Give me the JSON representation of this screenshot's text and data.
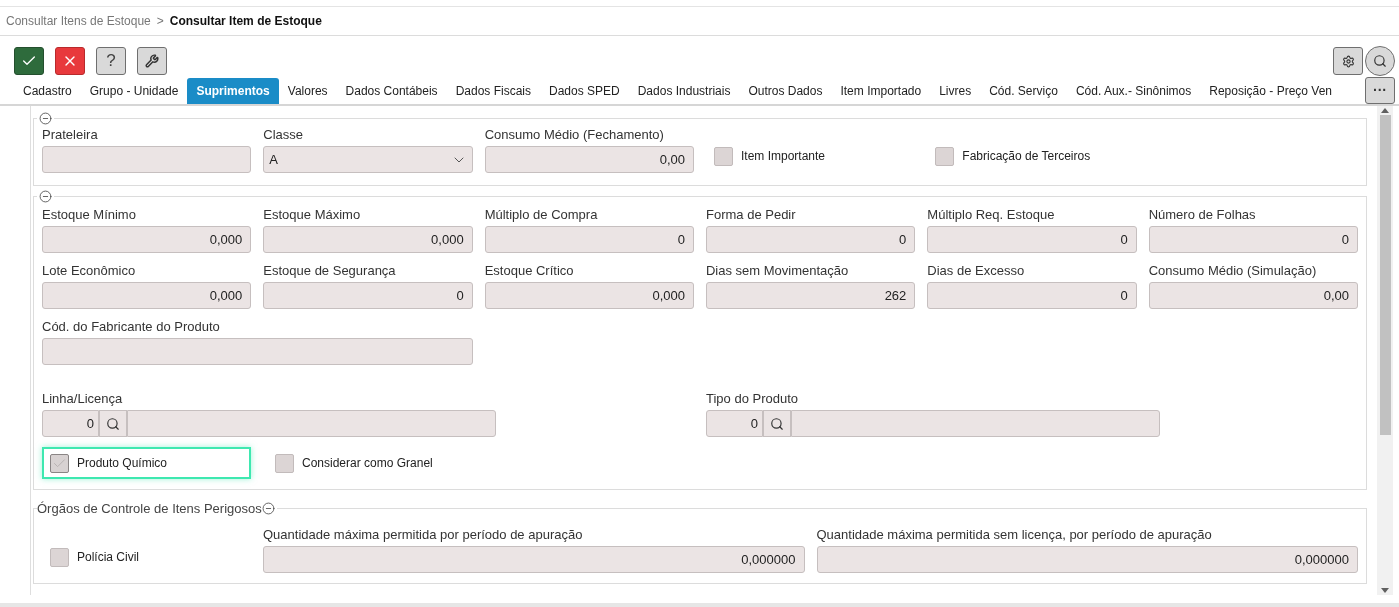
{
  "breadcrumb": [
    {
      "label": "Consultar Itens de Estoque",
      "current": false
    },
    {
      "label": ">",
      "current": false
    },
    {
      "label": "Consultar Item de Estoque",
      "current": true
    }
  ],
  "toolbar": [
    {
      "kind": "confirm"
    },
    {
      "kind": "cancel"
    },
    {
      "kind": "help",
      "label": "?"
    },
    {
      "kind": "tools"
    }
  ],
  "tabs": [
    {
      "label": "Cadastro",
      "selected": false
    },
    {
      "label": "Grupo - Unidade",
      "selected": false
    },
    {
      "label": "Suprimentos",
      "selected": true
    },
    {
      "label": "Valores",
      "selected": false
    },
    {
      "label": "Dados Contábeis",
      "selected": false
    },
    {
      "label": "Dados Fiscais",
      "selected": false
    },
    {
      "label": "Dados SPED",
      "selected": false
    },
    {
      "label": "Dados Industriais",
      "selected": false
    },
    {
      "label": "Outros Dados",
      "selected": false
    },
    {
      "label": "Item Importado",
      "selected": false
    },
    {
      "label": "Livres",
      "selected": false
    },
    {
      "label": "Cód. Serviço",
      "selected": false
    },
    {
      "label": "Cód. Aux.- Sinônimos",
      "selected": false
    },
    {
      "label": "Reposição - Preço Ven",
      "selected": false
    }
  ],
  "more_tabs": "···",
  "section_1": {
    "fields": [
      {
        "kind": "text",
        "label": "Prateleira"
      },
      {
        "kind": "select",
        "label": "Classe",
        "value": "A"
      },
      {
        "kind": "text",
        "label": "Consumo Médio (Fechamento)",
        "value": "0,00"
      },
      {
        "kind": "checkbox",
        "label": "Item Importante",
        "checked": false,
        "focused": false
      },
      {
        "kind": "checkbox",
        "label": "Fabricação de Terceiros",
        "checked": false,
        "focused": false
      }
    ]
  },
  "section_2": {
    "fields": [
      {
        "label": "Estoque Mínimo",
        "value": "0,000"
      },
      {
        "label": "Estoque Máximo",
        "value": "0,000"
      },
      {
        "label": "Múltiplo de Compra",
        "value": "0"
      },
      {
        "label": "Forma de Pedir",
        "value": "0"
      },
      {
        "label": "Múltiplo Req. Estoque",
        "value": "0"
      },
      {
        "label": "Número de Folhas",
        "value": "0"
      },
      {
        "label": "Lote Econômico",
        "value": "0,000"
      },
      {
        "label": "Estoque de Segurança",
        "value": "0"
      },
      {
        "label": "Estoque Crítico",
        "value": "0,000"
      },
      {
        "label": "Dias sem Movimentação",
        "value": "262"
      },
      {
        "label": "Dias de Excesso",
        "value": "0"
      },
      {
        "label": "Consumo Médio (Simulação)",
        "value": "0,00"
      }
    ],
    "manufacturer_code": {
      "label": "Cód. do Fabricante do Produto"
    },
    "lookups": [
      {
        "label": "Linha/Licença",
        "code": "0"
      },
      {
        "label": "Tipo do Produto",
        "code": "0"
      }
    ],
    "checkboxes": [
      {
        "label": "Produto Químico",
        "checked": true,
        "focused": true
      },
      {
        "label": "Considerar como Granel",
        "checked": false,
        "focused": false
      }
    ]
  },
  "section_3": {
    "title": "Órgãos de Controle de Itens Perigosos",
    "checkbox": {
      "label": "Polícia Civil",
      "checked": false,
      "focused": false
    },
    "fields": [
      {
        "label": "Quantidade máxima permitida por período de apuração",
        "value": "0,000000"
      },
      {
        "label": "Quantidade máxima permitida sem licença, por período de apuração",
        "value": "0,000000"
      }
    ]
  }
}
